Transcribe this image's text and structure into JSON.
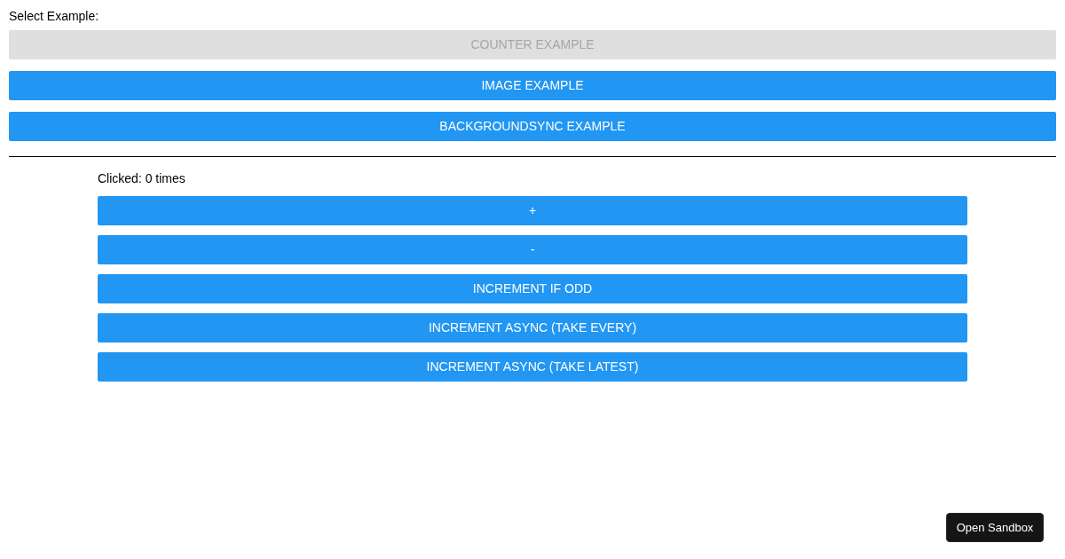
{
  "select_label": "Select Example:",
  "examples": [
    {
      "label": "COUNTER EXAMPLE",
      "selected": true
    },
    {
      "label": "IMAGE EXAMPLE",
      "selected": false
    },
    {
      "label": "BACKGROUNDSYNC EXAMPLE",
      "selected": false
    }
  ],
  "counter": {
    "status": "Clicked: 0 times",
    "buttons": [
      "+",
      "-",
      "INCREMENT IF ODD",
      "INCREMENT ASYNC (TAKE EVERY)",
      "INCREMENT ASYNC (TAKE LATEST)"
    ]
  },
  "sandbox_button": "Open Sandbox"
}
